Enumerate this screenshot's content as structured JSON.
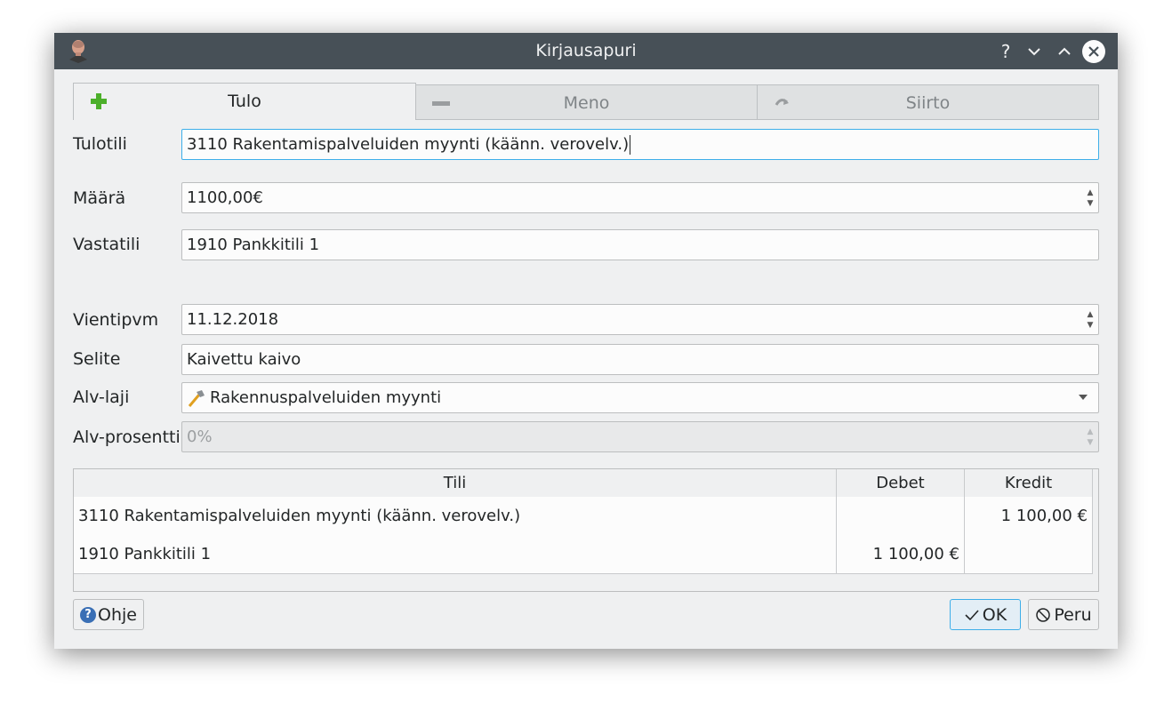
{
  "window": {
    "title": "Kirjausapuri",
    "controls": {
      "help": "?",
      "minimize": "⌄",
      "maximize": "⌃",
      "close": "✕"
    }
  },
  "tabs": [
    {
      "label": "Tulo",
      "icon": "plus-icon",
      "active": true
    },
    {
      "label": "Meno",
      "icon": "minus-icon",
      "active": false
    },
    {
      "label": "Siirto",
      "icon": "transfer-arrow-icon",
      "active": false
    }
  ],
  "form": {
    "tulotili": {
      "label": "Tulotili",
      "value": "3110 Rakentamispalveluiden myynti (käänn. verovelv.)"
    },
    "maara": {
      "label": "Määrä",
      "value": "1100,00€"
    },
    "vastatili": {
      "label": "Vastatili",
      "value": "1910 Pankkitili 1"
    },
    "vientipvm": {
      "label": "Vientipvm",
      "value": "11.12.2018"
    },
    "selite": {
      "label": "Selite",
      "value": "Kaivettu kaivo"
    },
    "alvlaji": {
      "label": "Alv-laji",
      "value": "Rakennuspalveluiden myynti",
      "icon": "hammer-icon"
    },
    "alvprosentti": {
      "label": "Alv-prosentti",
      "value": "0%"
    }
  },
  "table": {
    "headers": [
      "Tili",
      "Debet",
      "Kredit"
    ],
    "rows": [
      [
        "3110 Rakentamispalveluiden myynti (käänn. verovelv.)",
        "",
        "1 100,00 €"
      ],
      [
        "1910 Pankkitili 1",
        "1 100,00 €",
        ""
      ]
    ]
  },
  "buttons": {
    "help": "Ohje",
    "ok": "OK",
    "cancel": "Peru"
  },
  "colors": {
    "titlebar": "#475057",
    "window_bg": "#eff0f1",
    "focus": "#3daee9",
    "plus_green": "#4caf2a"
  }
}
